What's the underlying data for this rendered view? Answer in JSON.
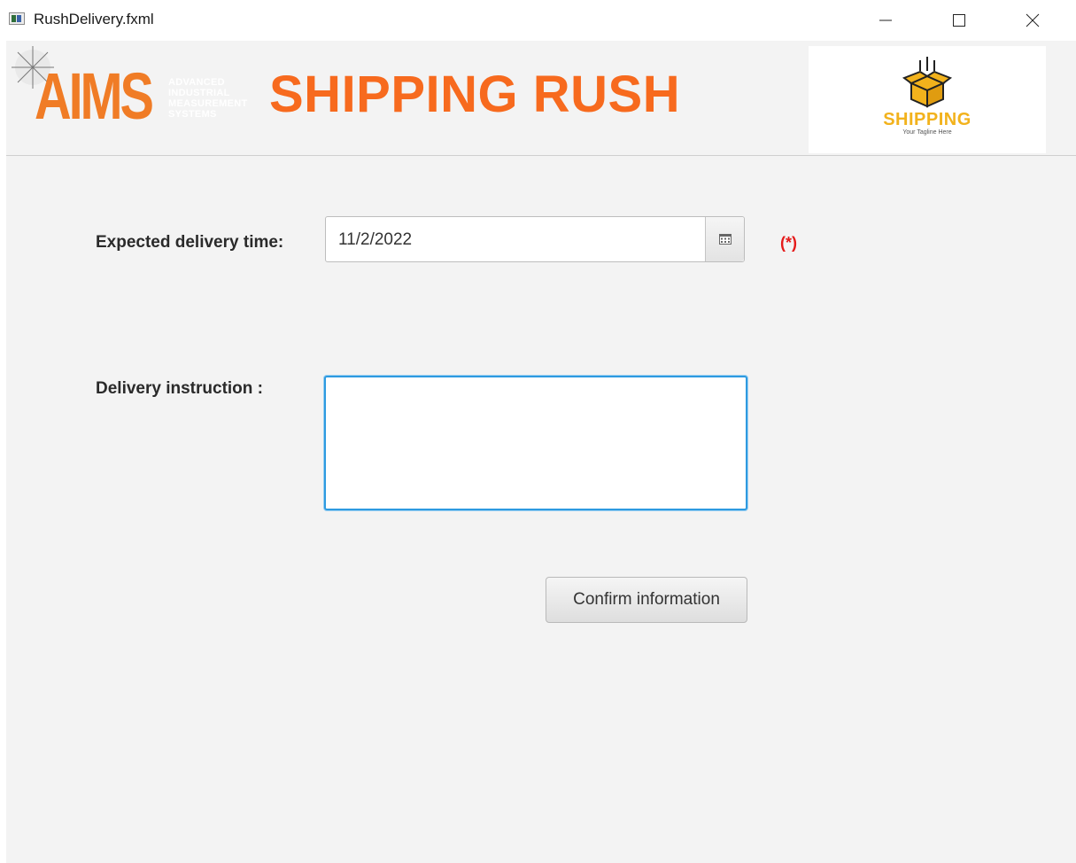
{
  "window": {
    "title": "RushDelivery.fxml",
    "controls": [
      "minimize-icon",
      "maximize-icon",
      "close-icon"
    ]
  },
  "header": {
    "aims_logo": {
      "text": "AIMS",
      "subtitle_lines": [
        "ADVANCED",
        "INDUSTRIAL",
        "MEASUREMENT",
        "SYSTEMS"
      ]
    },
    "title": "SHIPPING RUSH",
    "shipping_logo": {
      "word": "SHIPPING",
      "tagline": "Your Tagline Here"
    }
  },
  "form": {
    "delivery_time": {
      "label": "Expected delivery time:",
      "value": "11/2/2022",
      "required_marker": "(*)",
      "icon": "calendar-icon"
    },
    "instruction": {
      "label": "Delivery instruction :",
      "value": ""
    },
    "confirm_label": "Confirm information"
  },
  "colors": {
    "brand_orange": "#f76a1e",
    "logo_yellow": "#f2b21c",
    "required_red": "#e51a1a",
    "focus_blue": "#2e9ae0",
    "background": "#f3f3f3"
  }
}
